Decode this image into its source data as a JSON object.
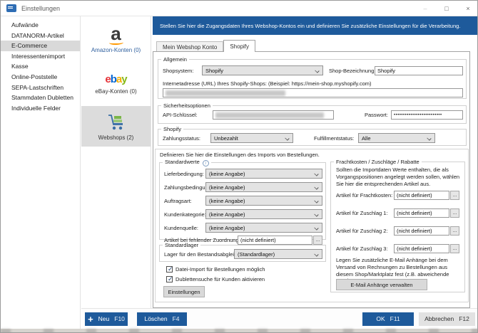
{
  "window": {
    "title": "Einstellungen",
    "minimize": "–",
    "maximize": "□",
    "close": "×"
  },
  "sidebar": {
    "items": [
      "Aufwände",
      "DATANORM-Artikel",
      "E-Commerce",
      "Interessentenimport",
      "Kasse",
      "Online-Poststelle",
      "SEPA-Lastschriften",
      "Stammdaten Dubletten",
      "Individuelle Felder"
    ]
  },
  "accounts": {
    "amazon_letter": "a",
    "ebay_letters": [
      "e",
      "b",
      "a",
      "y"
    ],
    "items": [
      {
        "label": "Amazon-Konten (0)"
      },
      {
        "label": "eBay-Konten (0)"
      },
      {
        "label": "Webshops (2)"
      }
    ]
  },
  "banner": {
    "text": "Stellen Sie hier die Zugangsdaten Ihres Webshop-Kontos ein und definieren Sie zusätzliche Einstellungen für die Verarbeitung."
  },
  "tabs": [
    {
      "label": "Mein Webshop Konto"
    },
    {
      "label": "Shopify"
    }
  ],
  "allgemein": {
    "legend": "Allgemein",
    "shopsystem_label": "Shopsystem:",
    "shopsystem_value": "Shopify",
    "bezeichnung_label": "Shop-Bezeichnung:",
    "bezeichnung_value": "Shopify",
    "url_label": "Internetadresse (URL) Ihres Shopify-Shops: (Beispiel: https://mein-shop.myshopify.com)"
  },
  "sicherheit": {
    "legend": "Sicherheitsoptionen",
    "api_label": "API-Schlüssel:",
    "passwort_label": "Passwort:",
    "passwort_mask": "••••••••••••••••••••••••••"
  },
  "shopify_status": {
    "legend": "Shopify",
    "zahlung_label": "Zahlungsstatus:",
    "zahlung_value": "Unbezahlt",
    "fulfillment_label": "Fulfillmentstatus:",
    "fulfillment_value": "Alle"
  },
  "import": {
    "intro": "Definieren Sie hier die Einstellungen des Imports von Bestellungen.",
    "browse_label": "...",
    "standardwerte": {
      "legend": "Standardwerte",
      "info_glyph": "i",
      "rows": [
        {
          "label": "Lieferbedingung:",
          "value": "(keine Angabe)"
        },
        {
          "label": "Zahlungsbedingung:",
          "value": "(keine Angabe)"
        },
        {
          "label": "Auftragsart:",
          "value": "(keine Angabe)"
        },
        {
          "label": "Kundenkategorie:",
          "value": "(keine Angabe)"
        },
        {
          "label": "Kundenquelle:",
          "value": "(keine Angabe)"
        }
      ],
      "artikel_label": "Artikel bei fehlender Zuordnung:",
      "artikel_value": "(nicht definiert)"
    },
    "standardlager": {
      "legend": "Standardlager",
      "lager_label": "Lager für den Bestandsabgleich:",
      "lager_value": "(Standardlager)",
      "checkboxes": [
        {
          "label": "Datei-Import für Bestellungen möglich",
          "checked": true
        },
        {
          "label": "Dublettensuche für Kunden aktivieren",
          "checked": true
        }
      ],
      "settings_button": "Einstellungen"
    },
    "fracht": {
      "legend": "Frachtkosten / Zuschläge / Rabatte",
      "description": "Sollten die Importdaten Werte enthalten, die als Vorgangs­positionen angelegt werden sollen, wählen Sie hier die entsprechenden Artikel aus.",
      "rows": [
        {
          "label": "Artikel für Frachtkosten:",
          "value": "(nicht definiert)"
        },
        {
          "label": "Artikel für Zuschlag 1:",
          "value": "(nicht definiert)"
        },
        {
          "label": "Artikel für Zuschlag 2:",
          "value": "(nicht definiert)"
        },
        {
          "label": "Artikel für Zuschlag 3:",
          "value": "(nicht definiert)"
        }
      ],
      "email_note": "Legen Sie zusätzliche E-Mail Anhänge bei dem Versand von Rechnungen zu Bestellungen aus diesem Shop/Marktplatz fest (z.B. abweichende AGB).",
      "email_button": "E-Mail Anhänge verwalten"
    }
  },
  "footer": {
    "plus": "+",
    "neu": "Neu",
    "neu_key": "F10",
    "loeschen": "Löschen",
    "loeschen_key": "F4",
    "ok": "OK",
    "ok_key": "F11",
    "abbrechen": "Abbrechen",
    "abbrechen_key": "F12"
  },
  "colors": {
    "accent_blue": "#1e5a9b",
    "banner_blue": "#1e5a9b",
    "selected_gray": "#d9d9d9"
  }
}
